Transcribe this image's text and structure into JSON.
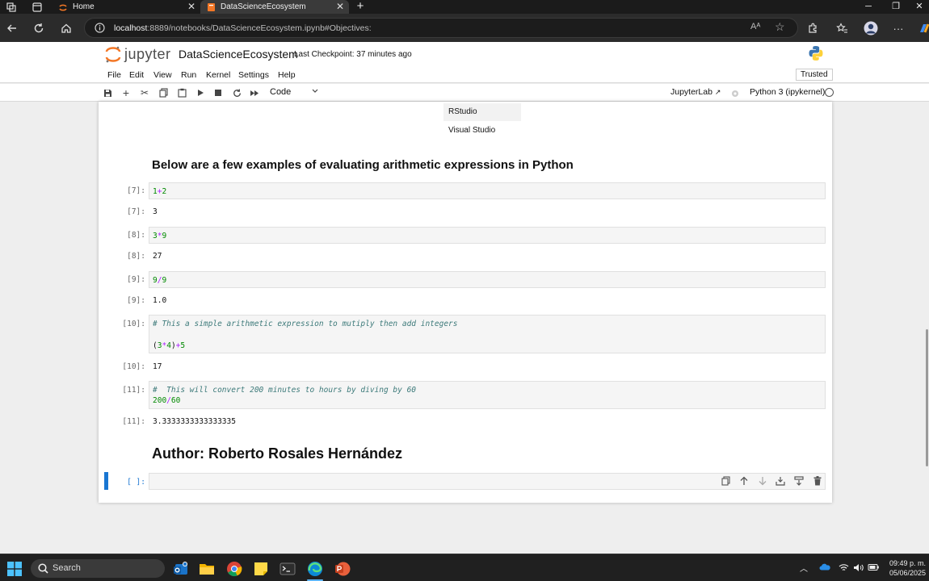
{
  "browser": {
    "tabs": [
      {
        "title": "Home"
      },
      {
        "title": "DataScienceEcosystem"
      }
    ],
    "url_host": "localhost",
    "url_rest": ":8889/notebooks/DataScienceEcosystem.ipynb#Objectives:"
  },
  "jupyter": {
    "logo_text": "jupyter",
    "notebook_name": "DataScienceEcosystem",
    "checkpoint": "Last Checkpoint: 37 minutes ago",
    "menu": [
      "File",
      "Edit",
      "View",
      "Run",
      "Kernel",
      "Settings",
      "Help"
    ],
    "trusted": "Trusted",
    "cell_type": "Code",
    "jupyterlab_link": "JupyterLab",
    "kernel": "Python 3 (ipykernel)"
  },
  "notebook": {
    "table_rows": [
      "RStudio",
      "Visual Studio"
    ],
    "heading_examples": "Below are a few examples of evaluating arithmetic expressions in Python",
    "cells": [
      {
        "prompt": "[7]:",
        "code": [
          {
            "a": "1",
            "op": "+",
            "b": "2"
          }
        ],
        "output": "3"
      },
      {
        "prompt": "[8]:",
        "code": [
          {
            "a": "3",
            "op": "*",
            "b": "9"
          }
        ],
        "output": "27"
      },
      {
        "prompt": "[9]:",
        "code": [
          {
            "a": "9",
            "op": "/",
            "b": "9"
          }
        ],
        "output": "1.0"
      },
      {
        "prompt": "[10]:",
        "comment": "# This a simple arithmetic expression to mutiply then add integers",
        "code_text": "(3*4)+5",
        "output": "17"
      },
      {
        "prompt": "[11]:",
        "comment": "#  This will convert 200 minutes to hours by diving by 60",
        "code_text": "200/60",
        "output": "3.3333333333333335"
      }
    ],
    "author_heading": "Author: Roberto Rosales Hernández",
    "empty_prompt": "[ ]:"
  },
  "taskbar": {
    "search": "Search",
    "time": "09:49 p. m.",
    "date": "05/06/2025"
  }
}
